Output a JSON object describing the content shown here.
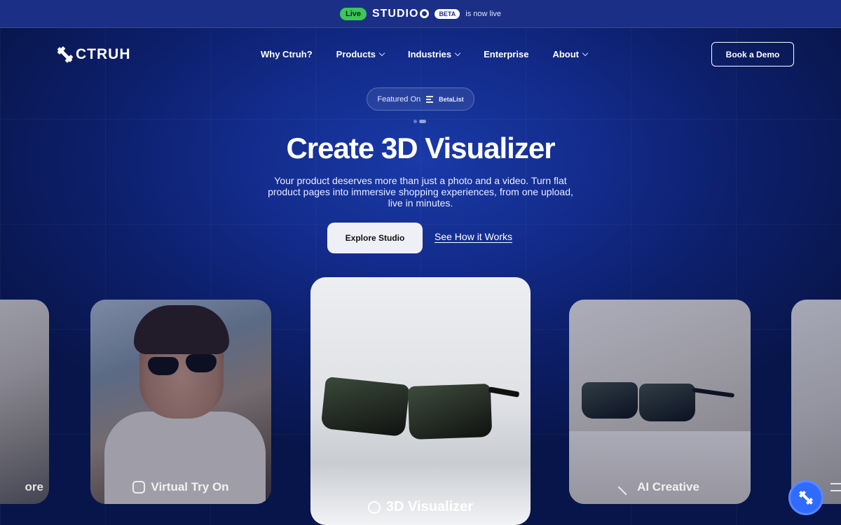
{
  "announcement": {
    "live_label": "Live",
    "studio_label": "STUDIO",
    "beta_label": "BETA",
    "text": "is now live"
  },
  "brand": {
    "name": "CTRUH"
  },
  "nav": {
    "items": [
      {
        "label": "Why Ctruh?",
        "dropdown": false
      },
      {
        "label": "Products",
        "dropdown": true
      },
      {
        "label": "Industries",
        "dropdown": true
      },
      {
        "label": "Enterprise",
        "dropdown": false
      },
      {
        "label": "About",
        "dropdown": true
      }
    ],
    "cta": "Book a Demo"
  },
  "featured": {
    "prefix": "Featured On",
    "name": "BetaList"
  },
  "hero": {
    "title": "Create 3D Visualizer",
    "subtitle": "Your product deserves more than just a photo and a video. Turn flat product pages into immersive shopping experiences, from one upload, live in minutes.",
    "primary_cta": "Explore Studio",
    "secondary_cta": "See How it Works"
  },
  "cards": {
    "far_left": "ore",
    "left": "Virtual Try On",
    "center": "3D Visualizer",
    "right": "AI Creative"
  },
  "colors": {
    "background": "#0d1f6b",
    "live_green": "#3cc65b",
    "fab_blue": "#2f6bff"
  }
}
